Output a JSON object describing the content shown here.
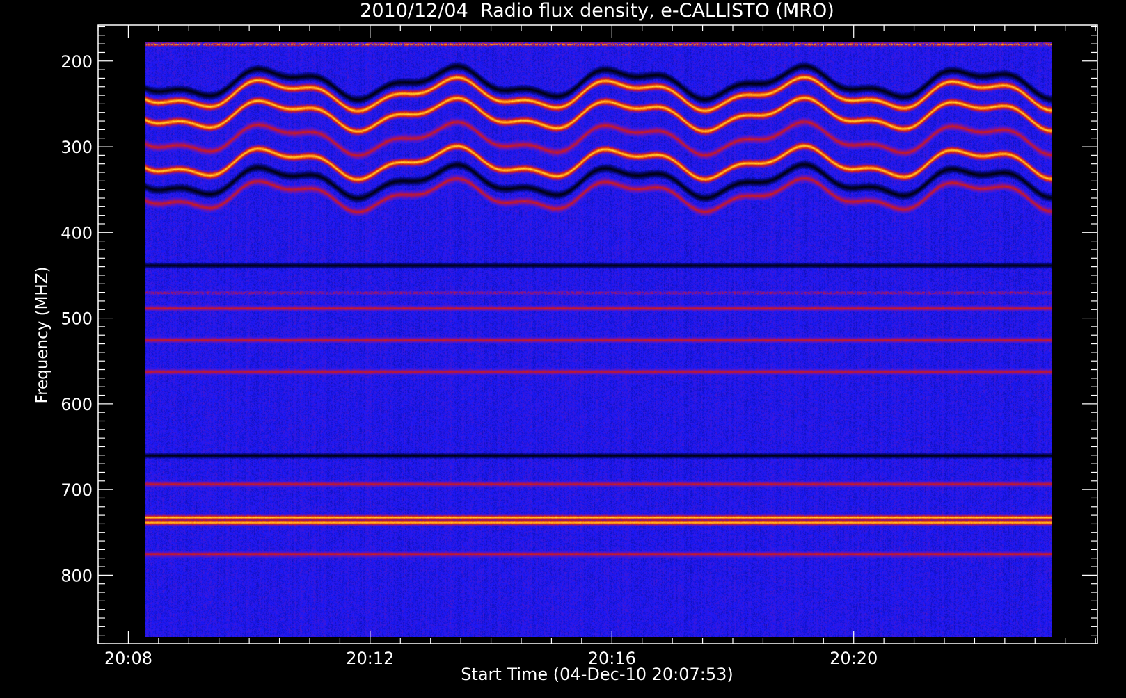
{
  "chart_data": {
    "type": "heatmap",
    "title": "2010/12/04  Radio flux density, e-CALLISTO (MRO)",
    "xlabel": "Start Time (04-Dec-10 20:07:53)",
    "ylabel": "Frequency (MHZ)",
    "x_tick_labels": [
      "20:08",
      "20:12",
      "20:16",
      "20:20"
    ],
    "x_tick_values_min": [
      0.117,
      4.117,
      8.117,
      12.117
    ],
    "y_tick_labels": [
      "200",
      "300",
      "400",
      "500",
      "600",
      "700",
      "800"
    ],
    "y_tick_values": [
      200,
      300,
      400,
      500,
      600,
      700,
      800
    ],
    "xlim_min_after_2007": [
      -0.383,
      16.15
    ],
    "ylim": [
      880,
      158
    ],
    "data_extent": {
      "time_min": [
        0.383,
        15.4
      ],
      "freq_mhz": [
        178,
        872
      ]
    },
    "colormap": {
      "background": "#1a1aff",
      "low": "#000000",
      "mid": "#cc1a1a",
      "high": "#ffdd33",
      "peak": "#ffffb0"
    },
    "bands_mhz": [
      {
        "freq": 180,
        "level": "high",
        "pattern": "speckle"
      },
      {
        "freq": 225,
        "level": "low",
        "pattern": "wavy"
      },
      {
        "freq": 238,
        "level": "high",
        "pattern": "wavy"
      },
      {
        "freq": 262,
        "level": "high",
        "pattern": "wavy"
      },
      {
        "freq": 290,
        "level": "mid",
        "pattern": "wavy"
      },
      {
        "freq": 318,
        "level": "high",
        "pattern": "wavy"
      },
      {
        "freq": 340,
        "level": "low",
        "pattern": "wavy"
      },
      {
        "freq": 356,
        "level": "mid",
        "pattern": "wavy"
      },
      {
        "freq": 438,
        "level": "low",
        "pattern": "band"
      },
      {
        "freq": 470,
        "level": "mid",
        "pattern": "speckle"
      },
      {
        "freq": 488,
        "level": "mid",
        "pattern": "band"
      },
      {
        "freq": 525,
        "level": "mid",
        "pattern": "band"
      },
      {
        "freq": 562,
        "level": "mid",
        "pattern": "band"
      },
      {
        "freq": 660,
        "level": "low",
        "pattern": "band"
      },
      {
        "freq": 693,
        "level": "mid",
        "pattern": "band"
      },
      {
        "freq": 732,
        "level": "high",
        "pattern": "band"
      },
      {
        "freq": 738,
        "level": "high",
        "pattern": "band"
      },
      {
        "freq": 775,
        "level": "mid",
        "pattern": "band"
      }
    ],
    "grid": false,
    "legend": "none"
  }
}
